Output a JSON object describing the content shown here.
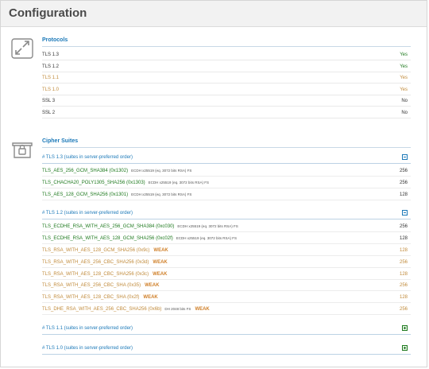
{
  "header": {
    "title": "Configuration"
  },
  "protocols": {
    "title": "Protocols",
    "icon": "expand-arrows-icon",
    "rows": [
      {
        "label": "TLS 1.3",
        "value": "Yes",
        "status": "green"
      },
      {
        "label": "TLS 1.2",
        "value": "Yes",
        "status": "green"
      },
      {
        "label": "TLS 1.1",
        "value": "Yes",
        "status": "orange"
      },
      {
        "label": "TLS 1.0",
        "value": "Yes",
        "status": "orange"
      },
      {
        "label": "SSL 3",
        "value": "No",
        "status": "dark"
      },
      {
        "label": "SSL 2",
        "value": "No",
        "status": "dark"
      }
    ]
  },
  "cipher_suites": {
    "title": "Cipher Suites",
    "icon": "lock-box-icon",
    "groups": [
      {
        "header": "# TLS 1.3 (suites in server-preferred order)",
        "toggle": "collapse",
        "suites": [
          {
            "name": "TLS_AES_256_GCM_SHA384",
            "code": "(0x1302)",
            "info": "ECDH x25519 (eq. 3072 bits RSA)   FS",
            "weak": "",
            "bits": "256",
            "status": "green"
          },
          {
            "name": "TLS_CHACHA20_POLY1305_SHA256",
            "code": "(0x1303)",
            "info": "ECDH x25519 (eq. 3072 bits RSA)   FS",
            "weak": "",
            "bits": "256",
            "status": "green"
          },
          {
            "name": "TLS_AES_128_GCM_SHA256",
            "code": "(0x1301)",
            "info": "ECDH x25519 (eq. 3072 bits RSA)   FS",
            "weak": "",
            "bits": "128",
            "status": "green"
          }
        ]
      },
      {
        "header": "# TLS 1.2 (suites in server-preferred order)",
        "toggle": "collapse",
        "suites": [
          {
            "name": "TLS_ECDHE_RSA_WITH_AES_256_GCM_SHA384",
            "code": "(0xc030)",
            "info": "ECDH x25519 (eq. 3072 bits RSA)   FS",
            "weak": "",
            "bits": "256",
            "status": "green"
          },
          {
            "name": "TLS_ECDHE_RSA_WITH_AES_128_GCM_SHA256",
            "code": "(0xc02f)",
            "info": "ECDH x25519 (eq. 3072 bits RSA)   FS",
            "weak": "",
            "bits": "128",
            "status": "green"
          },
          {
            "name": "TLS_RSA_WITH_AES_128_GCM_SHA256",
            "code": "(0x9c)",
            "info": "",
            "weak": "WEAK",
            "bits": "128",
            "status": "orange"
          },
          {
            "name": "TLS_RSA_WITH_AES_256_CBC_SHA256",
            "code": "(0x3d)",
            "info": "",
            "weak": "WEAK",
            "bits": "256",
            "status": "orange"
          },
          {
            "name": "TLS_RSA_WITH_AES_128_CBC_SHA256",
            "code": "(0x3c)",
            "info": "",
            "weak": "WEAK",
            "bits": "128",
            "status": "orange"
          },
          {
            "name": "TLS_RSA_WITH_AES_256_CBC_SHA",
            "code": "(0x35)",
            "info": "",
            "weak": "WEAK",
            "bits": "256",
            "status": "orange"
          },
          {
            "name": "TLS_RSA_WITH_AES_128_CBC_SHA",
            "code": "(0x2f)",
            "info": "",
            "weak": "WEAK",
            "bits": "128",
            "status": "orange"
          },
          {
            "name": "TLS_DHE_RSA_WITH_AES_256_CBC_SHA256",
            "code": "(0x6b)",
            "info": "DH 2048 bits   FS",
            "weak": "WEAK",
            "bits": "256",
            "status": "orange"
          }
        ]
      },
      {
        "header": "# TLS 1.1 (suites in server-preferred order)",
        "toggle": "expand",
        "suites": []
      },
      {
        "header": "# TLS 1.0 (suites in server-preferred order)",
        "toggle": "expand",
        "suites": []
      }
    ]
  },
  "colors": {
    "link": "#1a78b8",
    "good": "#1f7a1f",
    "warn": "#c08a3a",
    "weak": "#d0802a"
  }
}
